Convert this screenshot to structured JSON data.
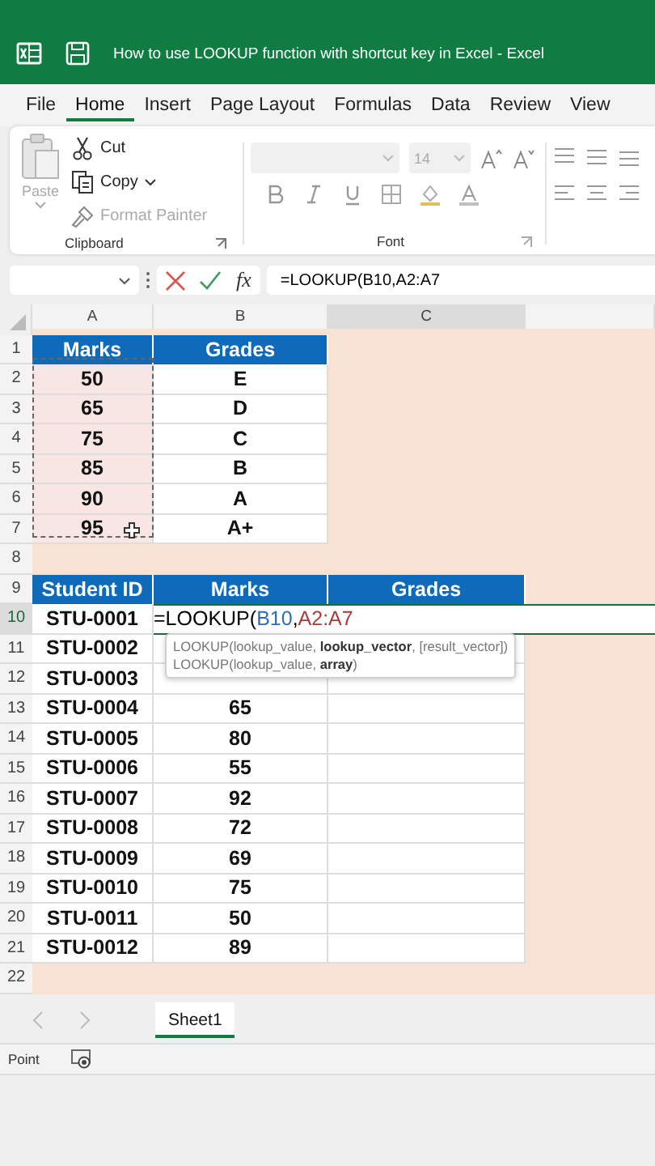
{
  "window": {
    "title": "How to use LOOKUP function with shortcut key in Excel  -  Excel"
  },
  "menu": [
    {
      "label": "File",
      "selected": false
    },
    {
      "label": "Home",
      "selected": true
    },
    {
      "label": "Insert",
      "selected": false
    },
    {
      "label": "Page Layout",
      "selected": false
    },
    {
      "label": "Formulas",
      "selected": false
    },
    {
      "label": "Data",
      "selected": false
    },
    {
      "label": "Review",
      "selected": false
    },
    {
      "label": "View",
      "selected": false
    }
  ],
  "clipboard": {
    "paste": {
      "label": "Paste",
      "disabled": true
    },
    "items": [
      {
        "kind": "cut",
        "label": "Cut",
        "disabled": false
      },
      {
        "kind": "copy",
        "label": "Copy",
        "disabled": false
      },
      {
        "kind": "painter",
        "label": "Format Painter",
        "disabled": true
      }
    ],
    "group_label": "Clipboard"
  },
  "font": {
    "size": "14",
    "group_label": "Font"
  },
  "formula_bar": {
    "function_label": "fx",
    "formula": "=LOOKUP(B10,A2:A7"
  },
  "columns": [
    {
      "label": "A",
      "selected": false
    },
    {
      "label": "B",
      "selected": false
    },
    {
      "label": "C",
      "selected": true
    }
  ],
  "rows": [
    {
      "number": "1",
      "selected": false,
      "cells": [
        {
          "kind": "header",
          "text": "Marks"
        },
        {
          "kind": "header",
          "text": "Grades"
        }
      ]
    },
    {
      "number": "2",
      "selected": false,
      "cells": [
        {
          "kind": "copied",
          "text": "50"
        },
        {
          "kind": "value",
          "text": "E"
        }
      ]
    },
    {
      "number": "3",
      "selected": false,
      "cells": [
        {
          "kind": "copied",
          "text": "65"
        },
        {
          "kind": "value",
          "text": "D"
        }
      ]
    },
    {
      "number": "4",
      "selected": false,
      "cells": [
        {
          "kind": "copied",
          "text": "75"
        },
        {
          "kind": "value",
          "text": "C"
        }
      ]
    },
    {
      "number": "5",
      "selected": false,
      "cells": [
        {
          "kind": "copied",
          "text": "85"
        },
        {
          "kind": "value",
          "text": "B"
        }
      ]
    },
    {
      "number": "6",
      "selected": false,
      "cells": [
        {
          "kind": "copied",
          "text": "90"
        },
        {
          "kind": "value",
          "text": "A"
        }
      ]
    },
    {
      "number": "7",
      "selected": false,
      "cells": [
        {
          "kind": "copied",
          "text": "95",
          "cursor": true
        },
        {
          "kind": "value",
          "text": "A+"
        }
      ]
    },
    {
      "number": "8",
      "selected": false,
      "cells": []
    },
    {
      "number": "9",
      "selected": false,
      "cells": [
        {
          "kind": "header",
          "text": "Student ID"
        },
        {
          "kind": "header",
          "text": "Marks"
        },
        {
          "kind": "header",
          "text": "Grades"
        }
      ]
    },
    {
      "number": "10",
      "selected": true,
      "cells": [
        {
          "kind": "value",
          "text": "STU-0001"
        },
        {
          "kind": "editing",
          "parts": [
            {
              "text": "=LOOKUP(",
              "color": "#000000"
            },
            {
              "text": "B10",
              "color": "#2f6eb5"
            },
            {
              "text": ",",
              "color": "#000000"
            },
            {
              "text": "A2:A7",
              "color": "#a83a3a"
            }
          ]
        }
      ]
    },
    {
      "number": "11",
      "selected": false,
      "cells": [
        {
          "kind": "value",
          "text": "STU-0002"
        },
        {
          "kind": "blank"
        },
        {
          "kind": "blank"
        }
      ]
    },
    {
      "number": "12",
      "selected": false,
      "cells": [
        {
          "kind": "value",
          "text": "STU-0003"
        },
        {
          "kind": "blank"
        },
        {
          "kind": "blank"
        }
      ]
    },
    {
      "number": "13",
      "selected": false,
      "cells": [
        {
          "kind": "value",
          "text": "STU-0004"
        },
        {
          "kind": "value",
          "text": "65"
        },
        {
          "kind": "blank"
        }
      ]
    },
    {
      "number": "14",
      "selected": false,
      "cells": [
        {
          "kind": "value",
          "text": "STU-0005"
        },
        {
          "kind": "value",
          "text": "80"
        },
        {
          "kind": "blank"
        }
      ]
    },
    {
      "number": "15",
      "selected": false,
      "cells": [
        {
          "kind": "value",
          "text": "STU-0006"
        },
        {
          "kind": "value",
          "text": "55"
        },
        {
          "kind": "blank"
        }
      ]
    },
    {
      "number": "16",
      "selected": false,
      "cells": [
        {
          "kind": "value",
          "text": "STU-0007"
        },
        {
          "kind": "value",
          "text": "92"
        },
        {
          "kind": "blank"
        }
      ]
    },
    {
      "number": "17",
      "selected": false,
      "cells": [
        {
          "kind": "value",
          "text": "STU-0008"
        },
        {
          "kind": "value",
          "text": "72"
        },
        {
          "kind": "blank"
        }
      ]
    },
    {
      "number": "18",
      "selected": false,
      "cells": [
        {
          "kind": "value",
          "text": "STU-0009"
        },
        {
          "kind": "value",
          "text": "69"
        },
        {
          "kind": "blank"
        }
      ]
    },
    {
      "number": "19",
      "selected": false,
      "cells": [
        {
          "kind": "value",
          "text": "STU-0010"
        },
        {
          "kind": "value",
          "text": "75"
        },
        {
          "kind": "blank"
        }
      ]
    },
    {
      "number": "20",
      "selected": false,
      "cells": [
        {
          "kind": "value",
          "text": "STU-0011"
        },
        {
          "kind": "value",
          "text": "50"
        },
        {
          "kind": "blank"
        }
      ]
    },
    {
      "number": "21",
      "selected": false,
      "cells": [
        {
          "kind": "value",
          "text": "STU-0012"
        },
        {
          "kind": "value",
          "text": "89"
        },
        {
          "kind": "blank"
        }
      ]
    },
    {
      "number": "22",
      "selected": false,
      "cells": []
    }
  ],
  "tooltip": {
    "lines": [
      "LOOKUP(lookup_value, **lookup_vector**, [result_vector])",
      "LOOKUP(lookup_value, **array**)"
    ]
  },
  "sheet_tabs": [
    {
      "label": "Sheet1",
      "selected": true
    }
  ],
  "status_bar": {
    "mode": "Point"
  }
}
